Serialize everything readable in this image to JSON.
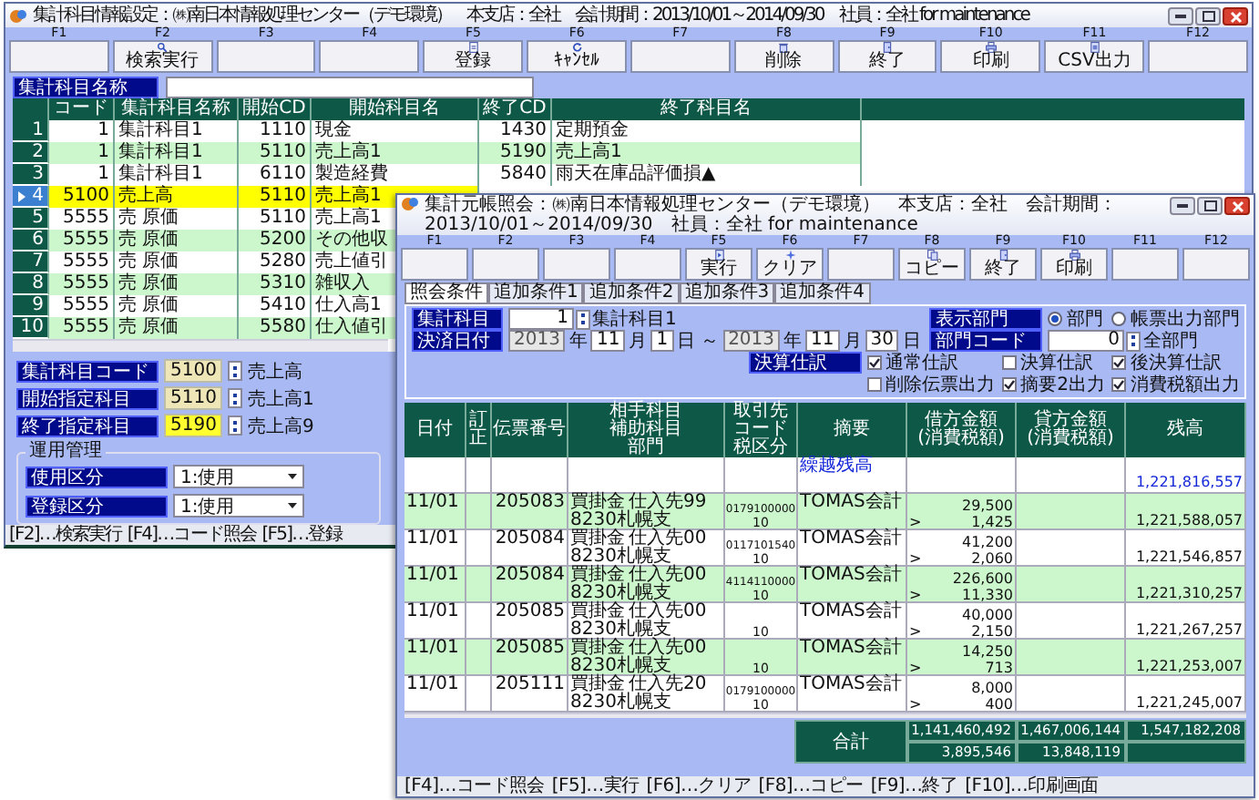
{
  "back_window": {
    "title": "集計科目情報設定：㈱南日本情報処理センター（デモ環境）　本支店：全社　会計期間：2013/10/01～2014/09/30　社員：全社 for maintenance",
    "function_keys": [
      {
        "key": "F1"
      },
      {
        "key": "F2",
        "label": "検索実行",
        "kind": "search"
      },
      {
        "key": "F3"
      },
      {
        "key": "F4"
      },
      {
        "key": "F5",
        "label": "登録",
        "kind": "save"
      },
      {
        "key": "F6",
        "label": "ｷｬﾝｾﾙ",
        "kind": "cancel"
      },
      {
        "key": "F7"
      },
      {
        "key": "F8",
        "label": "削除",
        "kind": "delete"
      },
      {
        "key": "F9",
        "label": "終了",
        "kind": "exit"
      },
      {
        "key": "F10",
        "label": "印刷",
        "kind": "print"
      },
      {
        "key": "F11",
        "label": "CSV出力",
        "kind": "csv"
      },
      {
        "key": "F12"
      }
    ],
    "name_field": {
      "label": "集計科目名称"
    },
    "table": {
      "columns": [
        "コード",
        "集計科目名称",
        "開始CD",
        "開始科目名",
        "終了CD",
        "終了科目名"
      ],
      "rows": [
        {
          "number": "1",
          "selected": false,
          "cells": [
            "1",
            "集計科目1",
            "1110",
            "現金",
            "1430",
            "定期預金"
          ]
        },
        {
          "number": "2",
          "selected": false,
          "cells": [
            "1",
            "集計科目1",
            "5110",
            "売上高1",
            "5190",
            "売上高1"
          ]
        },
        {
          "number": "3",
          "selected": false,
          "cells": [
            "1",
            "集計科目1",
            "6110",
            "製造経費",
            "5840",
            "雨天在庫品評価損▲"
          ]
        },
        {
          "number": "4",
          "selected": true,
          "cells": [
            "5100",
            "売上高",
            "5110",
            "売上高1"
          ]
        },
        {
          "number": "5",
          "selected": false,
          "cells": [
            "5555",
            "売 原価",
            "5110",
            "売上高1"
          ]
        },
        {
          "number": "6",
          "selected": false,
          "cells": [
            "5555",
            "売 原価",
            "5200",
            "その他収"
          ]
        },
        {
          "number": "7",
          "selected": false,
          "cells": [
            "5555",
            "売 原価",
            "5280",
            "売上値引"
          ]
        },
        {
          "number": "8",
          "selected": false,
          "cells": [
            "5555",
            "売 原価",
            "5310",
            "雑収入"
          ]
        },
        {
          "number": "9",
          "selected": false,
          "cells": [
            "5555",
            "売 原価",
            "5410",
            "仕入高1"
          ]
        },
        {
          "number": "10",
          "selected": false,
          "cells": [
            "5555",
            "売 原価",
            "5580",
            "仕入値引"
          ]
        }
      ]
    },
    "fields": [
      {
        "label": "集計科目コード",
        "code": "5100",
        "name": "売上高",
        "focused": false
      },
      {
        "label": "開始指定科目",
        "code": "5110",
        "name": "売上高1",
        "focused": false
      },
      {
        "label": "終了指定科目",
        "code": "5190",
        "name": "売上高9",
        "focused": true
      }
    ],
    "group": {
      "title": "運用管理",
      "selects": [
        {
          "label": "使用区分",
          "value": "1:使用"
        },
        {
          "label": "登録区分",
          "value": "1:使用"
        }
      ]
    },
    "key_guide": [
      "[F2]…検索実行",
      "[F4]…コード照会",
      "[F5]…登録"
    ]
  },
  "front_window": {
    "title": "集計元帳照会：㈱南日本情報処理センター（デモ環境）　本支店：全社　会計期間：2013/10/01～2014/09/30　社員：全社 for maintenance",
    "function_keys": [
      {
        "key": "F1"
      },
      {
        "key": "F2"
      },
      {
        "key": "F3"
      },
      {
        "key": "F4"
      },
      {
        "key": "F5",
        "label": "実行",
        "kind": "run"
      },
      {
        "key": "F6",
        "label": "クリア",
        "kind": "clear"
      },
      {
        "key": "F7"
      },
      {
        "key": "F8",
        "label": "コピー",
        "kind": "copy"
      },
      {
        "key": "F9",
        "label": "終了",
        "kind": "exit"
      },
      {
        "key": "F10",
        "label": "印刷",
        "kind": "print"
      },
      {
        "key": "F11"
      },
      {
        "key": "F12"
      }
    ],
    "tabs": [
      {
        "label": "照会条件",
        "selected": true
      },
      {
        "label": "追加条件1",
        "selected": false
      },
      {
        "label": "追加条件2",
        "selected": false
      },
      {
        "label": "追加条件3",
        "selected": false
      },
      {
        "label": "追加条件4",
        "selected": false
      }
    ],
    "account": {
      "label": "集計科目",
      "code": "1",
      "name": "集計科目1"
    },
    "date": {
      "label": "決済日付",
      "parts": [
        {
          "kind": "field",
          "value": "2013",
          "disabled": true
        },
        {
          "kind": "unit",
          "text": "年"
        },
        {
          "kind": "field",
          "value": "11",
          "disabled": false
        },
        {
          "kind": "unit",
          "text": "月"
        },
        {
          "kind": "field",
          "value": "1",
          "disabled": false
        },
        {
          "kind": "unit",
          "text": "日"
        },
        {
          "kind": "unit",
          "text": "～"
        },
        {
          "kind": "field",
          "value": "2013",
          "disabled": true
        },
        {
          "kind": "unit",
          "text": "年"
        },
        {
          "kind": "field",
          "value": "11",
          "disabled": false
        },
        {
          "kind": "unit",
          "text": "月"
        },
        {
          "kind": "field",
          "value": "30",
          "disabled": false
        },
        {
          "kind": "unit",
          "text": "日"
        }
      ]
    },
    "department": {
      "label": "表示部門",
      "options": [
        {
          "label": "部門",
          "selected": true
        },
        {
          "label": "帳票出力部門",
          "selected": false
        }
      ]
    },
    "department_code": {
      "label": "部門コード",
      "value": "0",
      "name": "全部門"
    },
    "journal": {
      "label": "決算仕訳",
      "checks": [
        {
          "label": "通常仕訳",
          "checked": true
        },
        {
          "label": "決算仕訳",
          "checked": false
        },
        {
          "label": "後決算仕訳",
          "checked": true
        },
        {
          "label": "削除伝票出力",
          "checked": false
        },
        {
          "label": "摘要2出力",
          "checked": true
        },
        {
          "label": "消費税額出力",
          "checked": true
        }
      ]
    },
    "table": {
      "columns": [
        [
          "日付"
        ],
        [
          "訂正"
        ],
        [
          "伝票番号"
        ],
        [
          "相手科目",
          "補助科目",
          "部門"
        ],
        [
          "取引先",
          "コード",
          "税区分"
        ],
        [
          "摘要"
        ],
        [
          "借方金額",
          "(消費税額)"
        ],
        [
          "貸方金額",
          "(消費税額)"
        ],
        [
          "残高"
        ]
      ],
      "rows": [
        {
          "kind": "carryover",
          "memo": "繰越残高",
          "balance": "1,221,816,557"
        },
        {
          "kind": "entry",
          "date": "11/01",
          "slip": "205083",
          "counter": [
            "買掛金",
            "仕入先99",
            "8230札幌支"
          ],
          "partner": [
            "0179100000",
            "10"
          ],
          "memo": "TOMAS会計",
          "mark": ">",
          "debit": "29,500",
          "debit_tax": "1,425",
          "balance": "1,221,588,057"
        },
        {
          "kind": "entry",
          "date": "11/01",
          "slip": "205084",
          "counter": [
            "買掛金",
            "仕入先00",
            "8230札幌支"
          ],
          "partner": [
            "0117101540",
            "10"
          ],
          "memo": "TOMAS会計",
          "mark": ">",
          "debit": "41,200",
          "debit_tax": "2,060",
          "balance": "1,221,546,857"
        },
        {
          "kind": "entry",
          "date": "11/01",
          "slip": "205084",
          "counter": [
            "買掛金",
            "仕入先00",
            "8230札幌支"
          ],
          "partner": [
            "4114110000",
            "10"
          ],
          "memo": "TOMAS会計",
          "mark": ">",
          "debit": "226,600",
          "debit_tax": "11,330",
          "balance": "1,221,310,257"
        },
        {
          "kind": "entry",
          "date": "11/01",
          "slip": "205085",
          "counter": [
            "買掛金",
            "仕入先00",
            "8230札幌支"
          ],
          "partner": [
            "10"
          ],
          "memo": "TOMAS会計",
          "mark": ">",
          "debit": "40,000",
          "debit_tax": "2,150",
          "balance": "1,221,267,257"
        },
        {
          "kind": "entry",
          "date": "11/01",
          "slip": "205085",
          "counter": [
            "買掛金",
            "仕入先00",
            "8230札幌支"
          ],
          "partner": [
            "10"
          ],
          "memo": "TOMAS会計",
          "mark": ">",
          "debit": "14,250",
          "debit_tax": "713",
          "balance": "1,221,253,007"
        },
        {
          "kind": "entry",
          "date": "11/01",
          "slip": "205111",
          "counter": [
            "買掛金",
            "仕入先20",
            "8230札幌支"
          ],
          "partner": [
            "0179100000",
            "10"
          ],
          "memo": "TOMAS会計",
          "mark": ">",
          "debit": "8,000",
          "debit_tax": "400",
          "balance": "1,221,245,007"
        }
      ]
    },
    "totals": {
      "label": "合計",
      "debit": "1,141,460,492",
      "credit": "1,467,006,144",
      "balance": "1,547,182,208",
      "debit_tax": "3,895,546",
      "credit_tax": "13,848,119"
    },
    "key_guide": [
      "[F4]…コード照会",
      "[F5]…実行",
      "[F6]…クリア",
      "[F8]…コピー",
      "[F9]…終了",
      "[F10]…印刷画面"
    ]
  }
}
